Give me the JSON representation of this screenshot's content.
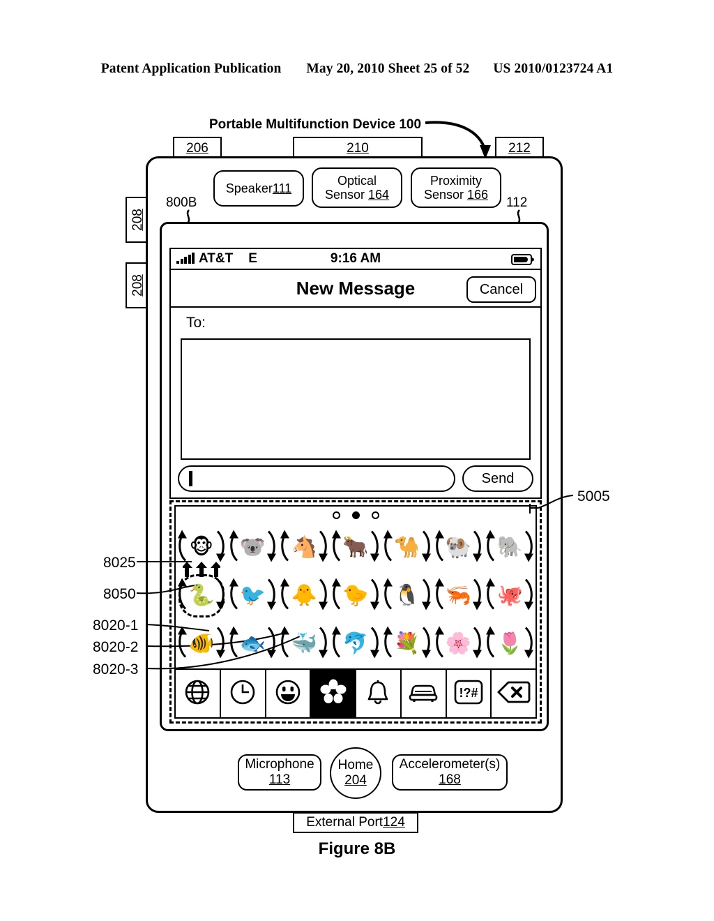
{
  "patent_header": {
    "left": "Patent Application Publication",
    "middle": "May 20, 2010  Sheet 25 of 52",
    "right": "US 2010/0123724 A1"
  },
  "figure": {
    "caption": "Figure 8B",
    "device_title": "Portable Multifunction Device 100"
  },
  "numerals": {
    "top_left": "206",
    "top_center": "210",
    "top_right": "212",
    "side_upper": "208",
    "side_lower": "208",
    "screen_left": "800B",
    "screen_right": "112",
    "keyboard": "5005",
    "ref_8025": "8025",
    "ref_8050": "8050",
    "ref_8020_1": "8020-1",
    "ref_8020_2": "8020-2",
    "ref_8020_3": "8020-3"
  },
  "sensors": {
    "speaker_label": "Speaker ",
    "speaker_num": "111",
    "optical_label": "Optical",
    "optical_label2": "Sensor ",
    "optical_num": "164",
    "proximity_label": "Proximity",
    "proximity_label2": "Sensor ",
    "proximity_num": "166"
  },
  "status_bar": {
    "carrier": "AT&T",
    "network": "E",
    "time": "9:16 AM",
    "signal_icon": "signal-bars-icon",
    "battery_icon": "battery-icon"
  },
  "nav_bar": {
    "title": "New Message",
    "cancel": "Cancel"
  },
  "compose": {
    "to_label": "To:",
    "text_value": "",
    "send": "Send"
  },
  "keyboard": {
    "page_dots": [
      {
        "active": false
      },
      {
        "active": true
      },
      {
        "active": false
      }
    ],
    "rows": [
      [
        {
          "glyph": "🐵",
          "name": "monkey-face-emoji",
          "selected": false
        },
        {
          "glyph": "🐨",
          "name": "koala-emoji",
          "selected": false
        },
        {
          "glyph": "🐴",
          "name": "horse-face-emoji",
          "selected": false
        },
        {
          "glyph": "🐂",
          "name": "ox-emoji",
          "selected": false
        },
        {
          "glyph": "🐪",
          "name": "camel-emoji",
          "selected": false
        },
        {
          "glyph": "🐏",
          "name": "ram-emoji",
          "selected": false
        },
        {
          "glyph": "🐘",
          "name": "elephant-emoji",
          "selected": false
        }
      ],
      [
        {
          "glyph": "🐍",
          "name": "snake-emoji",
          "selected": true
        },
        {
          "glyph": "🐦",
          "name": "bird-emoji",
          "selected": false
        },
        {
          "glyph": "🐥",
          "name": "front-facing-baby-chick-emoji",
          "selected": false
        },
        {
          "glyph": "🐤",
          "name": "baby-chick-emoji",
          "selected": false
        },
        {
          "glyph": "🐧",
          "name": "penguin-emoji",
          "selected": false
        },
        {
          "glyph": "🦐",
          "name": "shrimp-emoji",
          "selected": false
        },
        {
          "glyph": "🐙",
          "name": "octopus-emoji",
          "selected": false
        }
      ],
      [
        {
          "glyph": "🐠",
          "name": "tropical-fish-emoji",
          "selected": false
        },
        {
          "glyph": "🐟",
          "name": "fish-emoji",
          "selected": false
        },
        {
          "glyph": "🐳",
          "name": "whale-emoji",
          "selected": false
        },
        {
          "glyph": "🐬",
          "name": "dolphin-emoji",
          "selected": false
        },
        {
          "glyph": "💐",
          "name": "bouquet-emoji",
          "selected": false
        },
        {
          "glyph": "🌸",
          "name": "cherry-blossom-emoji",
          "selected": false
        },
        {
          "glyph": "🌷",
          "name": "tulip-emoji",
          "selected": false
        }
      ]
    ],
    "toolbar": [
      {
        "name": "globe-icon",
        "label": "",
        "selected": false
      },
      {
        "name": "clock-icon",
        "label": "",
        "selected": false
      },
      {
        "name": "smiley-icon",
        "label": "",
        "selected": false
      },
      {
        "name": "flower-icon",
        "label": "",
        "selected": true
      },
      {
        "name": "bell-icon",
        "label": "",
        "selected": false
      },
      {
        "name": "car-icon",
        "label": "",
        "selected": false
      },
      {
        "name": "symbols-icon",
        "label": "!?#",
        "selected": false
      },
      {
        "name": "delete-key-icon",
        "label": "",
        "selected": false
      }
    ]
  },
  "hardware": {
    "microphone_label": "Microphone",
    "microphone_num": "113",
    "home_label": "Home",
    "home_num": "204",
    "accelerometer_label": "Accelerometer(s)",
    "accelerometer_num": "168",
    "external_port_label": "External Port ",
    "external_port_num": "124"
  }
}
